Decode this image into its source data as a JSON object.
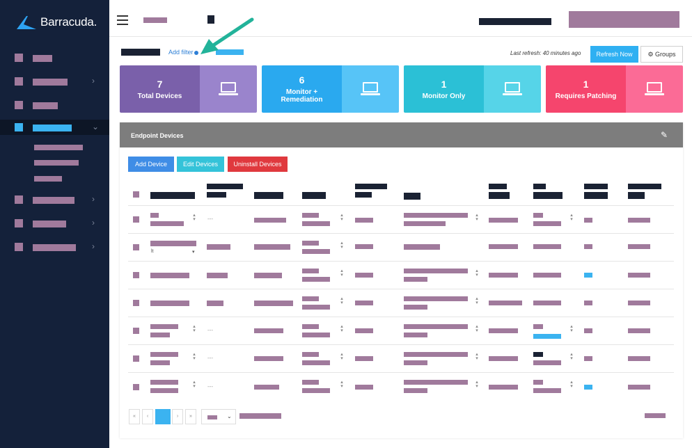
{
  "app": {
    "logo_text": "Barracuda."
  },
  "filter_bar": {
    "add_filter": "Add filter",
    "last_refresh": "Last refresh: 40 minutes ago",
    "refresh_button": "Refresh Now",
    "groups_button": "Groups"
  },
  "cards": [
    {
      "count": "7",
      "label": "Total Devices",
      "color_left": "#7a60aa",
      "color_right": "#9a84cc"
    },
    {
      "count": "6",
      "label": "Monitor + Remediation",
      "color_left": "#2aa9ef",
      "color_right": "#57c4f7"
    },
    {
      "count": "1",
      "label": "Monitor Only",
      "color_left": "#2bc0d6",
      "color_right": "#56d4e8"
    },
    {
      "count": "1",
      "label": "Requires Patching",
      "color_left": "#f5456d",
      "color_right": "#fb6b96"
    }
  ],
  "panel": {
    "title": "Endpoint Devices",
    "buttons": {
      "add": "Add Device",
      "edit": "Edit Devices",
      "uninstall": "Uninstall Devices"
    }
  },
  "table": {
    "row2_fragment": "lt",
    "empty_marker": "---"
  },
  "pagination": {
    "first": "«",
    "prev": "‹",
    "next": "›",
    "last": "»"
  },
  "colors": {
    "sidebar": "#14213a",
    "accent": "#3bb3f0",
    "danger": "#e0393e",
    "header_gray": "#7d7d7d"
  }
}
